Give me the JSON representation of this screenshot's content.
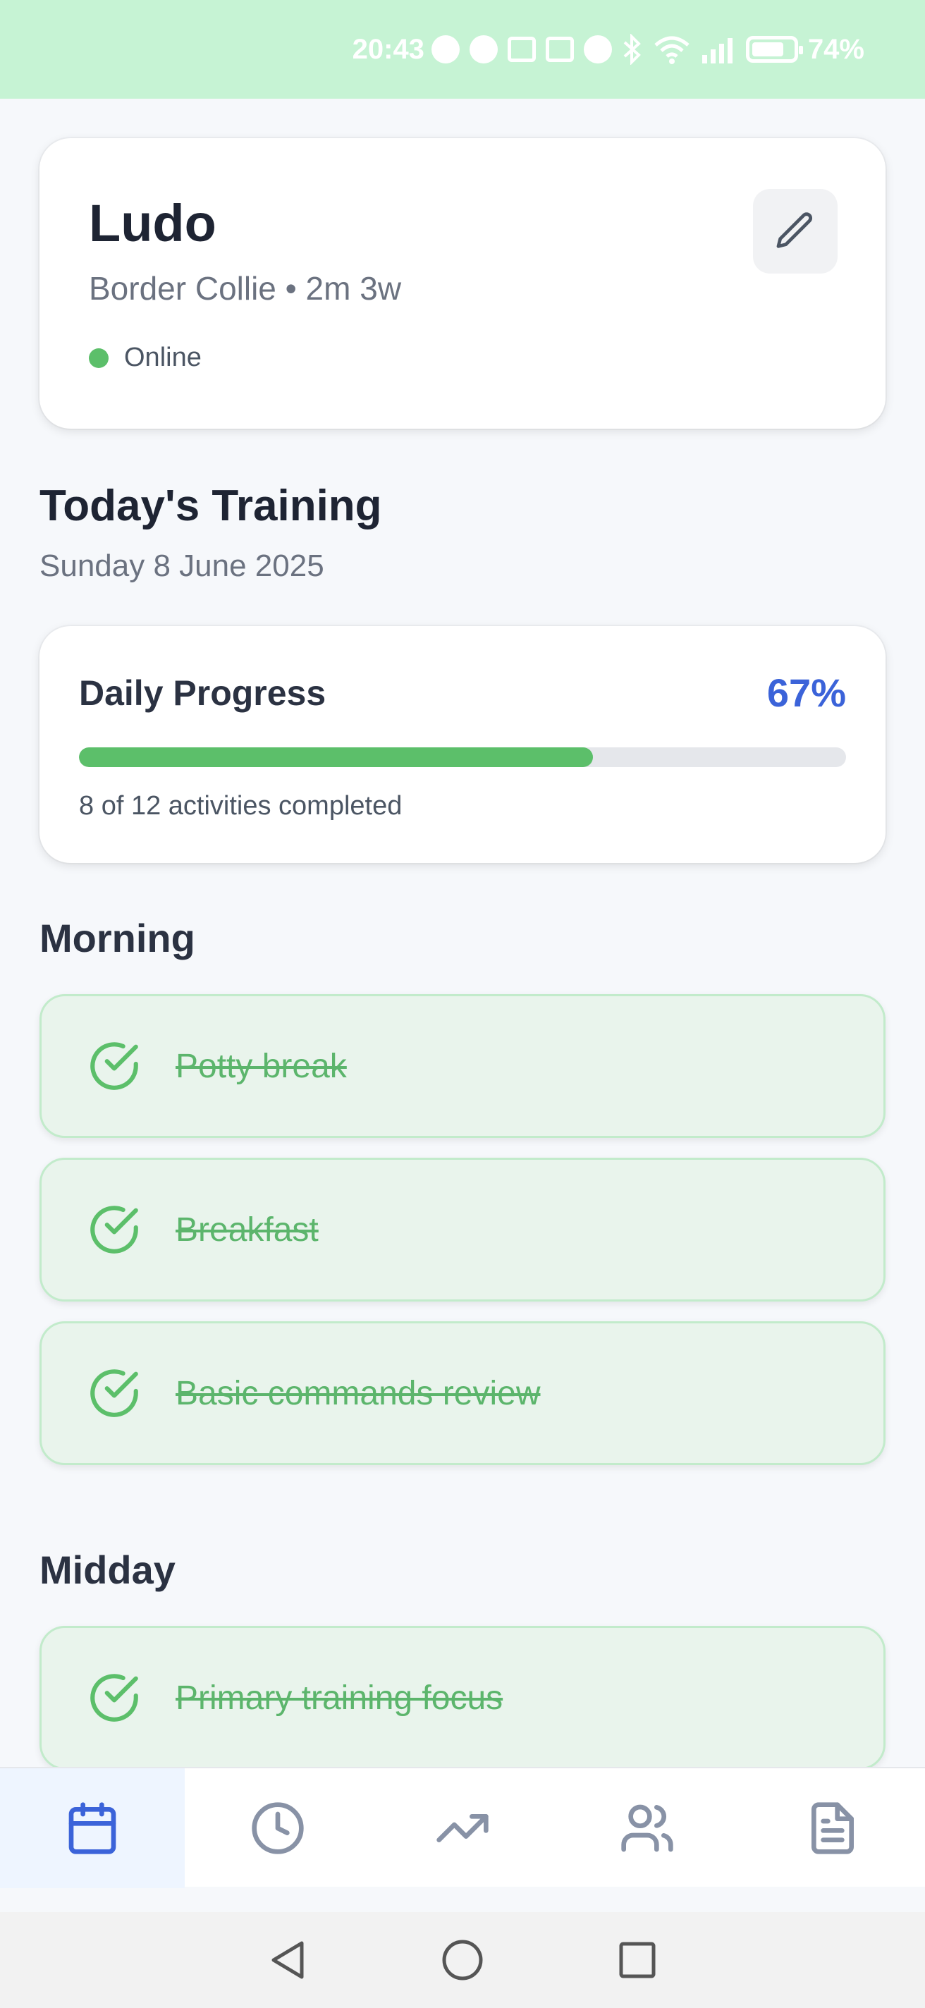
{
  "status_bar": {
    "time": "20:43",
    "battery": "74%"
  },
  "profile": {
    "name": "Ludo",
    "breed_age": "Border Collie • 2m 3w",
    "status": "Online"
  },
  "today": {
    "title": "Today's Training",
    "date": "Sunday 8 June 2025"
  },
  "progress": {
    "title": "Daily Progress",
    "percent_label": "67%",
    "fraction": 0.67,
    "summary": "8 of 12 activities completed"
  },
  "sections": {
    "morning": {
      "title": "Morning",
      "items": [
        "Potty break",
        "Breakfast",
        "Basic commands review"
      ]
    },
    "midday": {
      "title": "Midday",
      "items": [
        "Primary training focus"
      ]
    }
  },
  "bottom_nav": {
    "items": [
      "calendar-icon",
      "clock-icon",
      "trending-up-icon",
      "users-icon",
      "document-icon"
    ],
    "active": "calendar-icon"
  },
  "colors": {
    "accent_blue": "#3b63d9",
    "success_green": "#5cbf6a",
    "status_bar": "#c6f3d4"
  }
}
